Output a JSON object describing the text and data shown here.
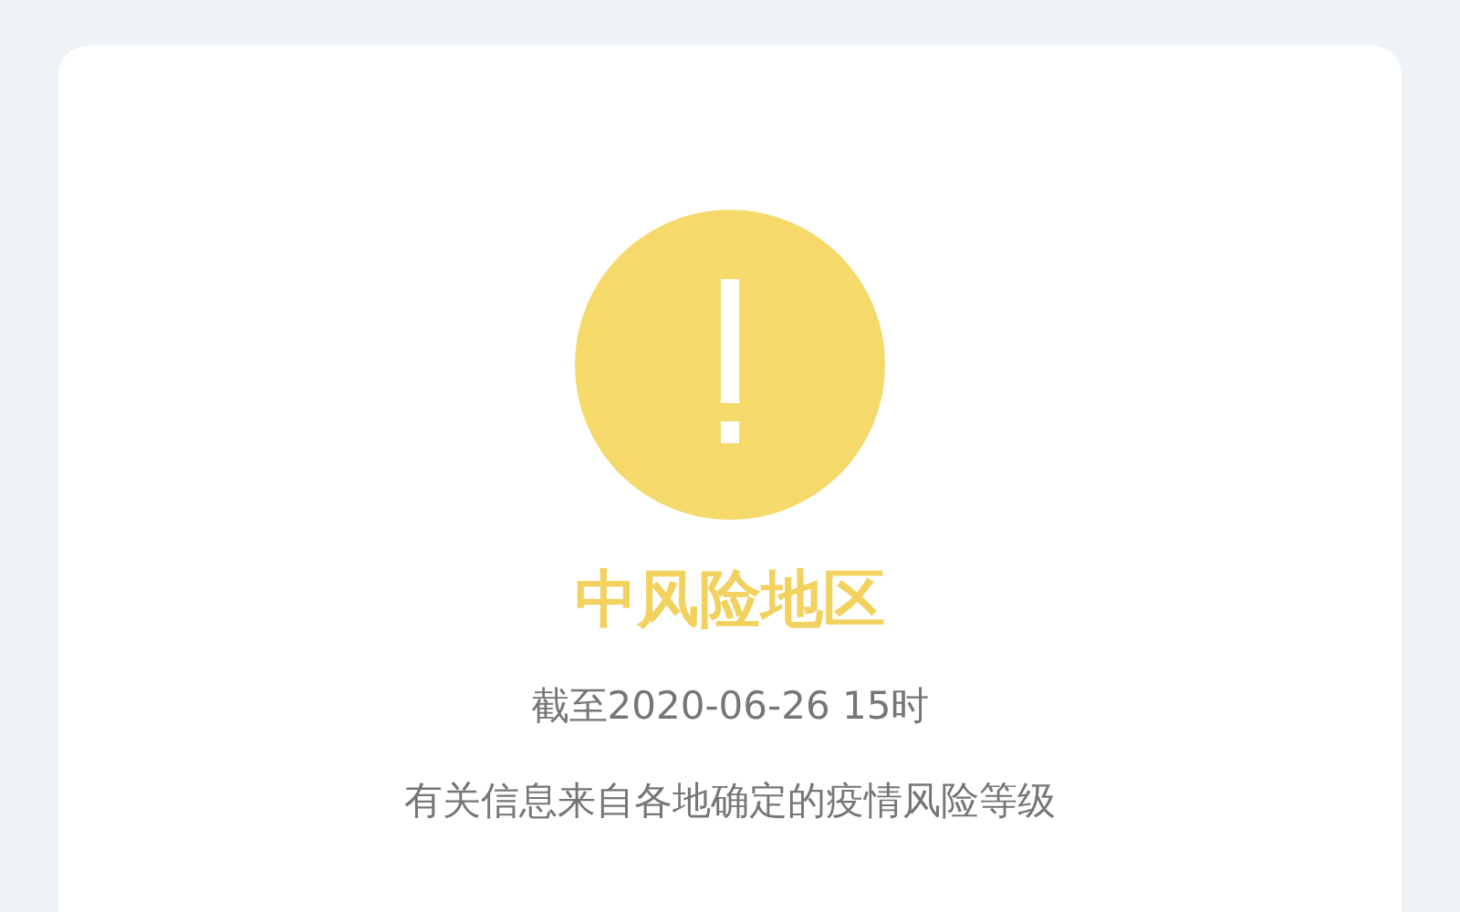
{
  "risk": {
    "kind": "medium",
    "title": "中风险地区"
  },
  "as_of": "截至2020-06-26 15时",
  "note": "有关信息来自各地确定的疫情风险等级"
}
